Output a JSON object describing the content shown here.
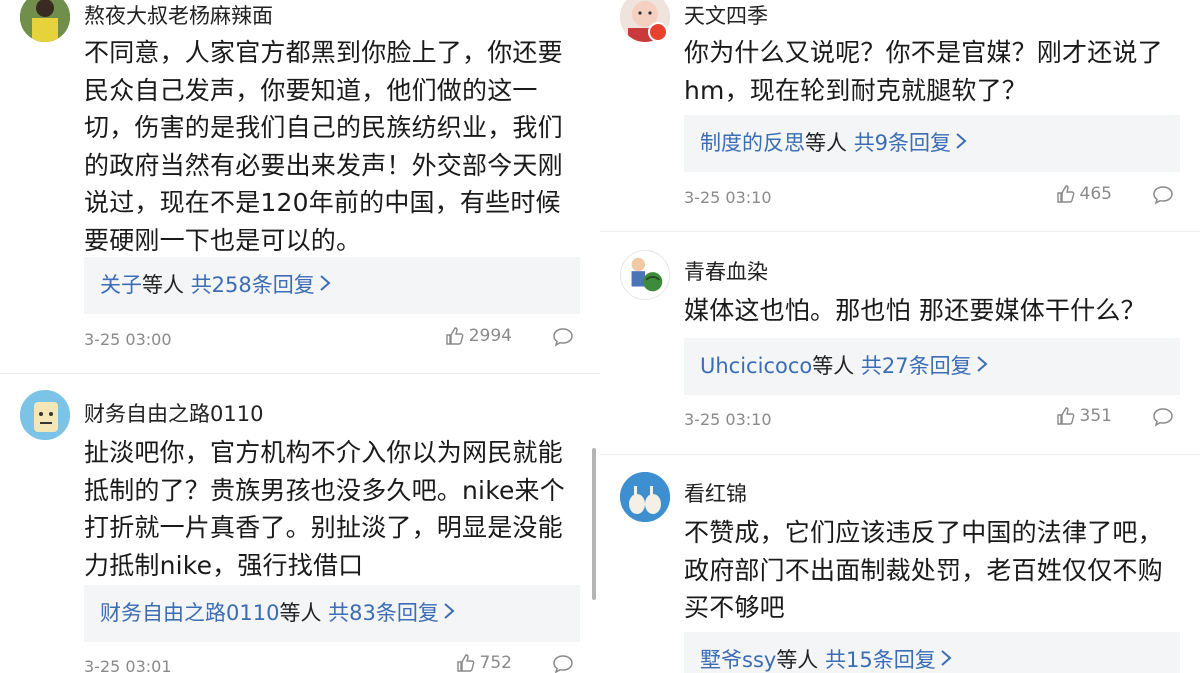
{
  "comments": [
    {
      "username": "熬夜大叔老杨麻辣面",
      "text": "不同意，人家官方都黑到你脸上了，你还要\n民众自己发声，你要知道，他们做的这一\n切，伤害的是我们自己的民族纺织业，我们\n的政府当然有必要出来发声！外交部今天刚\n说过，现在不是120年前的中国，有些时候\n要硬刚一下也是可以的。",
      "reply_from": "关子",
      "reply_etc": "等人",
      "reply_count": "共258条回复",
      "time": "3-25 03:00",
      "likes": "2994"
    },
    {
      "username": "财务自由之路0110",
      "text": "扯淡吧你，官方机构不介入你以为网民就能\n抵制的了？贵族男孩也没多久吧。nike来个\n打折就一片真香了。别扯淡了，明显是没能\n力抵制nike，强行找借口",
      "reply_from": "财务自由之路0110",
      "reply_etc": "等人",
      "reply_count": "共83条回复",
      "time": "3-25 03:01",
      "likes": "752"
    },
    {
      "username": "天文四季",
      "text": "你为什么又说呢？你不是官媒？刚才还说了\nhm，现在轮到耐克就腿软了？",
      "reply_from": "制度的反思",
      "reply_etc": "等人",
      "reply_count": "共9条回复",
      "time": "3-25 03:10",
      "likes": "465"
    },
    {
      "username": "青春血染",
      "text": "媒体这也怕。那也怕 那还要媒体干什么？",
      "reply_from": "Uhcicicoco",
      "reply_etc": "等人",
      "reply_count": "共27条回复",
      "time": "3-25 03:10",
      "likes": "351"
    },
    {
      "username": "看红锦",
      "text": "不赞成，它们应该违反了中国的法律了吧，\n政府部门不出面制裁处罚，老百姓仅仅不购\n买不够吧",
      "reply_from": "墅爷ssy",
      "reply_etc": "等人",
      "reply_count": "共15条回复",
      "time": "",
      "likes": ""
    }
  ],
  "icons": {
    "like": "thumbs-up-icon",
    "comment": "comment-bubble-icon",
    "chevron": "chevron-right-icon"
  },
  "colors": {
    "link": "#3b6db5",
    "reply_bg": "#f4f5f7",
    "meta": "#8a8a8a"
  }
}
